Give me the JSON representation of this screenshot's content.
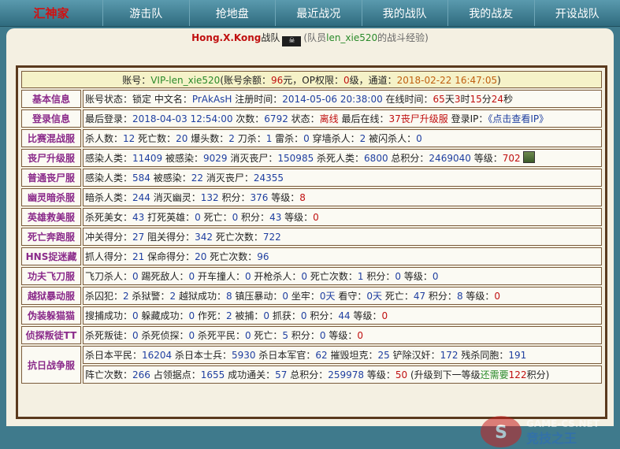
{
  "nav": {
    "logo": "汇神家",
    "items": [
      "游击队",
      "抢地盘",
      "最近战况",
      "我的战队",
      "我的战友",
      "开设战队"
    ]
  },
  "title": {
    "team": "Hong.X.Kong",
    "suffix": "战队",
    "flag_text": "☠",
    "paren_open": "(队员",
    "member": "len_xie520",
    "paren_close": "的战斗经验)"
  },
  "account": {
    "prefix": "账号：",
    "vip": "VIP-len_xie520",
    "a": "(账号余额：",
    "balance": "96",
    "b": "元，OP权限：",
    "op": "0",
    "c": "级，通道：",
    "channel": "2018-02-22 16:47:05",
    "d": ")"
  },
  "rows": [
    {
      "label": "基本信息",
      "segs": [
        [
          "账号状态：锁定 中文名：",
          ""
        ],
        [
          "PrAkAsH",
          "b"
        ],
        [
          " 注册时间：",
          ""
        ],
        [
          "2014-05-06 20:38:00",
          "b"
        ],
        [
          " 在线时间：",
          ""
        ],
        [
          "65",
          "r"
        ],
        [
          "天",
          ""
        ],
        [
          "3",
          "r"
        ],
        [
          "时",
          ""
        ],
        [
          "15",
          "r"
        ],
        [
          "分",
          ""
        ],
        [
          "24",
          "r"
        ],
        [
          "秒",
          ""
        ]
      ]
    },
    {
      "label": "登录信息",
      "segs": [
        [
          "最后登录：",
          ""
        ],
        [
          "2018-04-03 12:54:00",
          "b"
        ],
        [
          " 次数：",
          ""
        ],
        [
          "6792",
          "b"
        ],
        [
          " 状态：",
          ""
        ],
        [
          "离线",
          "r"
        ],
        [
          " 最后在线：",
          ""
        ],
        [
          "37丧尸升级服",
          "r"
        ],
        [
          " 登录IP：",
          ""
        ],
        [
          "《点击查看IP》",
          "b"
        ]
      ]
    },
    {
      "label": "比赛混战服",
      "segs": [
        [
          "杀人数：",
          ""
        ],
        [
          "12",
          "b"
        ],
        [
          " 死亡数：",
          ""
        ],
        [
          "20",
          "b"
        ],
        [
          " 爆头数：",
          ""
        ],
        [
          "2",
          "b"
        ],
        [
          " 刀杀：",
          ""
        ],
        [
          "1",
          "b"
        ],
        [
          " 雷杀：",
          ""
        ],
        [
          "0",
          "b"
        ],
        [
          " 穿墙杀人：",
          ""
        ],
        [
          "2",
          "b"
        ],
        [
          " 被闪杀人：",
          ""
        ],
        [
          "0",
          "b"
        ]
      ]
    },
    {
      "label": "丧尸升级服",
      "segs": [
        [
          "感染人类：",
          ""
        ],
        [
          "11409",
          "b"
        ],
        [
          " 被感染：",
          ""
        ],
        [
          "9029",
          "b"
        ],
        [
          " 消灭丧尸：",
          ""
        ],
        [
          "150985",
          "b"
        ],
        [
          " 杀死人类：",
          ""
        ],
        [
          "6800",
          "b"
        ],
        [
          " 总积分：",
          ""
        ],
        [
          "2469040",
          "b"
        ],
        [
          " 等级：",
          ""
        ],
        [
          "702",
          "r"
        ],
        [
          " ",
          ""
        ]
      ],
      "avatar": true
    },
    {
      "label": "普通丧尸服",
      "segs": [
        [
          "感染人类：",
          ""
        ],
        [
          "584",
          "b"
        ],
        [
          " 被感染：",
          ""
        ],
        [
          "22",
          "b"
        ],
        [
          " 消灭丧尸：",
          ""
        ],
        [
          "24355",
          "b"
        ]
      ]
    },
    {
      "label": "幽灵暗杀服",
      "segs": [
        [
          "暗杀人类：",
          ""
        ],
        [
          "244",
          "b"
        ],
        [
          " 消灭幽灵：",
          ""
        ],
        [
          "132",
          "b"
        ],
        [
          " 积分：",
          ""
        ],
        [
          "376",
          "b"
        ],
        [
          " 等级：",
          ""
        ],
        [
          "8",
          "r"
        ]
      ]
    },
    {
      "label": "英雄救美服",
      "segs": [
        [
          "杀死美女：",
          ""
        ],
        [
          "43",
          "b"
        ],
        [
          " 打死英雄：",
          ""
        ],
        [
          "0",
          "b"
        ],
        [
          " 死亡：",
          ""
        ],
        [
          "0",
          "b"
        ],
        [
          " 积分：",
          ""
        ],
        [
          "43",
          "b"
        ],
        [
          " 等级：",
          ""
        ],
        [
          "0",
          "r"
        ]
      ]
    },
    {
      "label": "死亡奔跑服",
      "segs": [
        [
          "冲关得分：",
          ""
        ],
        [
          "27",
          "b"
        ],
        [
          " 阻关得分：",
          ""
        ],
        [
          "342",
          "b"
        ],
        [
          " 死亡次数：",
          ""
        ],
        [
          "722",
          "b"
        ]
      ]
    },
    {
      "label": "HNS捉迷藏",
      "segs": [
        [
          "抓人得分：",
          ""
        ],
        [
          "21",
          "b"
        ],
        [
          " 保命得分：",
          ""
        ],
        [
          "20",
          "b"
        ],
        [
          " 死亡次数：",
          ""
        ],
        [
          "96",
          "b"
        ]
      ]
    },
    {
      "label": "功夫飞刀服",
      "segs": [
        [
          "飞刀杀人：",
          ""
        ],
        [
          "0",
          "b"
        ],
        [
          " 踢死敌人：",
          ""
        ],
        [
          "0",
          "b"
        ],
        [
          " 开车撞人：",
          ""
        ],
        [
          "0",
          "b"
        ],
        [
          " 开枪杀人：",
          ""
        ],
        [
          "0",
          "b"
        ],
        [
          " 死亡次数：",
          ""
        ],
        [
          "1",
          "b"
        ],
        [
          " 积分：",
          ""
        ],
        [
          "0",
          "b"
        ],
        [
          " 等级：",
          ""
        ],
        [
          "0",
          "b"
        ]
      ]
    },
    {
      "label": "越狱暴动服",
      "segs": [
        [
          "杀囚犯：",
          ""
        ],
        [
          "2",
          "b"
        ],
        [
          " 杀狱警：",
          ""
        ],
        [
          "2",
          "b"
        ],
        [
          " 越狱成功：",
          ""
        ],
        [
          "8",
          "b"
        ],
        [
          " 镇压暴动：",
          ""
        ],
        [
          "0",
          "b"
        ],
        [
          " 坐牢：",
          ""
        ],
        [
          "0天",
          "b"
        ],
        [
          " 看守：",
          ""
        ],
        [
          "0天",
          "b"
        ],
        [
          " 死亡：",
          ""
        ],
        [
          "47",
          "b"
        ],
        [
          " 积分：",
          ""
        ],
        [
          "8",
          "b"
        ],
        [
          " 等级：",
          ""
        ],
        [
          "0",
          "r"
        ]
      ]
    },
    {
      "label": "伪装躲猫猫",
      "segs": [
        [
          "搜捕成功：",
          ""
        ],
        [
          "0",
          "b"
        ],
        [
          " 躲藏成功：",
          ""
        ],
        [
          "0",
          "b"
        ],
        [
          " 作死：",
          ""
        ],
        [
          "2",
          "b"
        ],
        [
          " 被捕：",
          ""
        ],
        [
          "0",
          "b"
        ],
        [
          " 抓获：",
          ""
        ],
        [
          "0",
          "b"
        ],
        [
          " 积分：",
          ""
        ],
        [
          "44",
          "b"
        ],
        [
          " 等级：",
          ""
        ],
        [
          "0",
          "r"
        ]
      ]
    },
    {
      "label": "侦探叛徒TT",
      "segs": [
        [
          "杀死叛徒：",
          ""
        ],
        [
          "0",
          "b"
        ],
        [
          " 杀死侦探：",
          ""
        ],
        [
          "0",
          "b"
        ],
        [
          " 杀死平民：",
          ""
        ],
        [
          "0",
          "b"
        ],
        [
          " 死亡：",
          ""
        ],
        [
          "5",
          "b"
        ],
        [
          " 积分：",
          ""
        ],
        [
          "0",
          "b"
        ],
        [
          " 等级：",
          ""
        ],
        [
          "0",
          "r"
        ]
      ]
    }
  ],
  "war": {
    "label": "抗日战争服",
    "line1": [
      [
        "杀日本平民：",
        ""
      ],
      [
        "16204",
        "b"
      ],
      [
        " 杀日本士兵：",
        ""
      ],
      [
        "5930",
        "b"
      ],
      [
        " 杀日本军官：",
        ""
      ],
      [
        "62",
        "b"
      ],
      [
        " 摧毁坦克：",
        ""
      ],
      [
        "25",
        "b"
      ],
      [
        " 铲除汉奸：",
        ""
      ],
      [
        "172",
        "b"
      ],
      [
        " 残杀同胞：",
        ""
      ],
      [
        "191",
        "b"
      ]
    ],
    "line2": [
      [
        "阵亡次数：",
        ""
      ],
      [
        "266",
        "b"
      ],
      [
        " 占领据点：",
        ""
      ],
      [
        "1655",
        "b"
      ],
      [
        " 成功通关：",
        ""
      ],
      [
        "57",
        "b"
      ],
      [
        " 总积分：",
        ""
      ],
      [
        "259978",
        "b"
      ],
      [
        " 等级：",
        ""
      ],
      [
        "50",
        "r"
      ],
      [
        " (升级到下一等级",
        ""
      ],
      [
        "还需要",
        "g"
      ],
      [
        "122",
        "r"
      ],
      [
        "积分)",
        ""
      ]
    ]
  },
  "watermark": {
    "text": "GAME-CS.NET",
    "sub": "竞技之王"
  }
}
